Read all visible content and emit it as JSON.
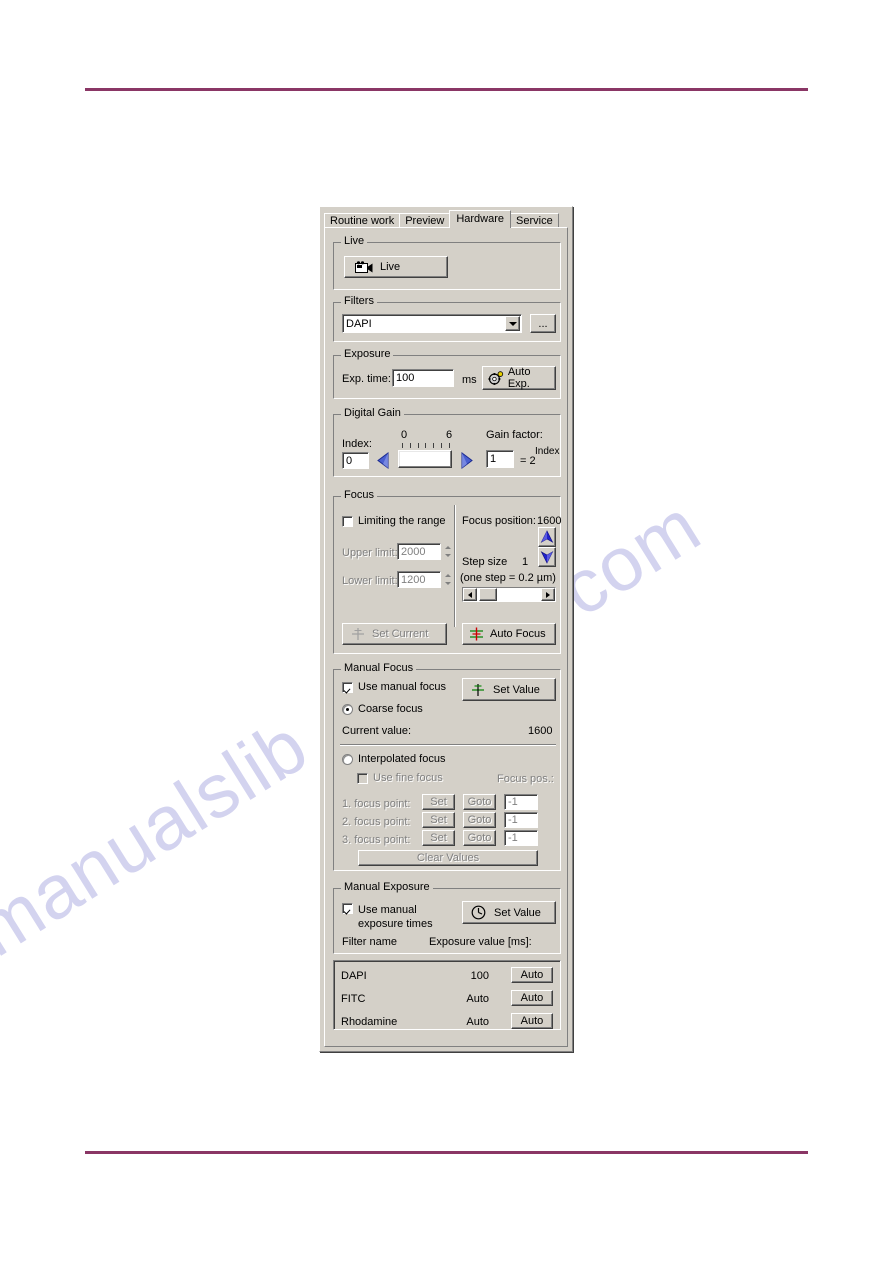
{
  "page": {
    "rule_color": "#8a3665",
    "watermark_left": "manualslib",
    "watermark_right": "com"
  },
  "dialog": {
    "tabs": [
      {
        "label": "Routine work",
        "active": false
      },
      {
        "label": "Preview",
        "active": false
      },
      {
        "label": "Hardware",
        "active": true
      },
      {
        "label": "Service",
        "active": false
      }
    ],
    "live": {
      "title": "Live",
      "button_label": "Live",
      "icon": "video-camera-icon"
    },
    "filters": {
      "title": "Filters",
      "selected": "DAPI",
      "browse_label": "..."
    },
    "exposure": {
      "title": "Exposure",
      "exp_time_label": "Exp. time:",
      "exp_time_value": "100",
      "unit": "ms",
      "auto_exp_label": "Auto Exp.",
      "auto_exp_icon": "gear-icon"
    },
    "digital_gain": {
      "title": "Digital Gain",
      "index_label": "Index:",
      "index_value": "0",
      "slider_min_label": "0",
      "slider_max_label": "6",
      "slider_ticks": 7,
      "slider_value": 0,
      "gain_factor_label": "Gain factor:",
      "gain_factor_value": "1",
      "equals_label": "= 2",
      "exponent_label": "Index"
    },
    "focus": {
      "title": "Focus",
      "limiting_label": "Limiting the range",
      "limiting_checked": false,
      "upper_limit_label": "Upper limit:",
      "upper_limit_value": "2000",
      "lower_limit_label": "Lower limit:",
      "lower_limit_value": "1200",
      "focus_position_label": "Focus position:",
      "focus_position_value": "1600",
      "step_size_label": "Step size",
      "step_size_value": "1",
      "step_note": "(one step = 0.2 µm)",
      "set_current_label": "Set Current",
      "set_current_icon": "focus-set-icon",
      "auto_focus_label": "Auto Focus",
      "auto_focus_icon": "auto-focus-icon"
    },
    "manual_focus": {
      "title": "Manual Focus",
      "use_manual_label": "Use manual focus",
      "use_manual_checked": true,
      "set_value_label": "Set Value",
      "set_value_icon": "focus-set-icon",
      "coarse_label": "Coarse focus",
      "coarse_selected": true,
      "current_value_label": "Current value:",
      "current_value": "1600",
      "interpolated_label": "Interpolated focus",
      "interpolated_selected": false,
      "use_fine_label": "Use fine focus",
      "use_fine_checked": false,
      "focus_pos_header": "Focus pos.:",
      "focus_points": [
        {
          "label": "1. focus point:",
          "set": "Set",
          "goto": "Goto",
          "pos": "-1"
        },
        {
          "label": "2. focus point:",
          "set": "Set",
          "goto": "Goto",
          "pos": "-1"
        },
        {
          "label": "3. focus point:",
          "set": "Set",
          "goto": "Goto",
          "pos": "-1"
        }
      ],
      "clear_values_label": "Clear Values"
    },
    "manual_exposure": {
      "title": "Manual Exposure",
      "use_manual_line1": "Use manual",
      "use_manual_line2": "exposure times",
      "use_manual_checked": true,
      "set_value_label": "Set Value",
      "set_value_icon": "clock-icon",
      "col_name_header": "Filter name",
      "col_value_header": "Exposure value [ms]:",
      "rows": [
        {
          "name": "DAPI",
          "value": "100",
          "button": "Auto"
        },
        {
          "name": "FITC",
          "value": "Auto",
          "button": "Auto"
        },
        {
          "name": "Rhodamine",
          "value": "Auto",
          "button": "Auto"
        }
      ]
    }
  }
}
